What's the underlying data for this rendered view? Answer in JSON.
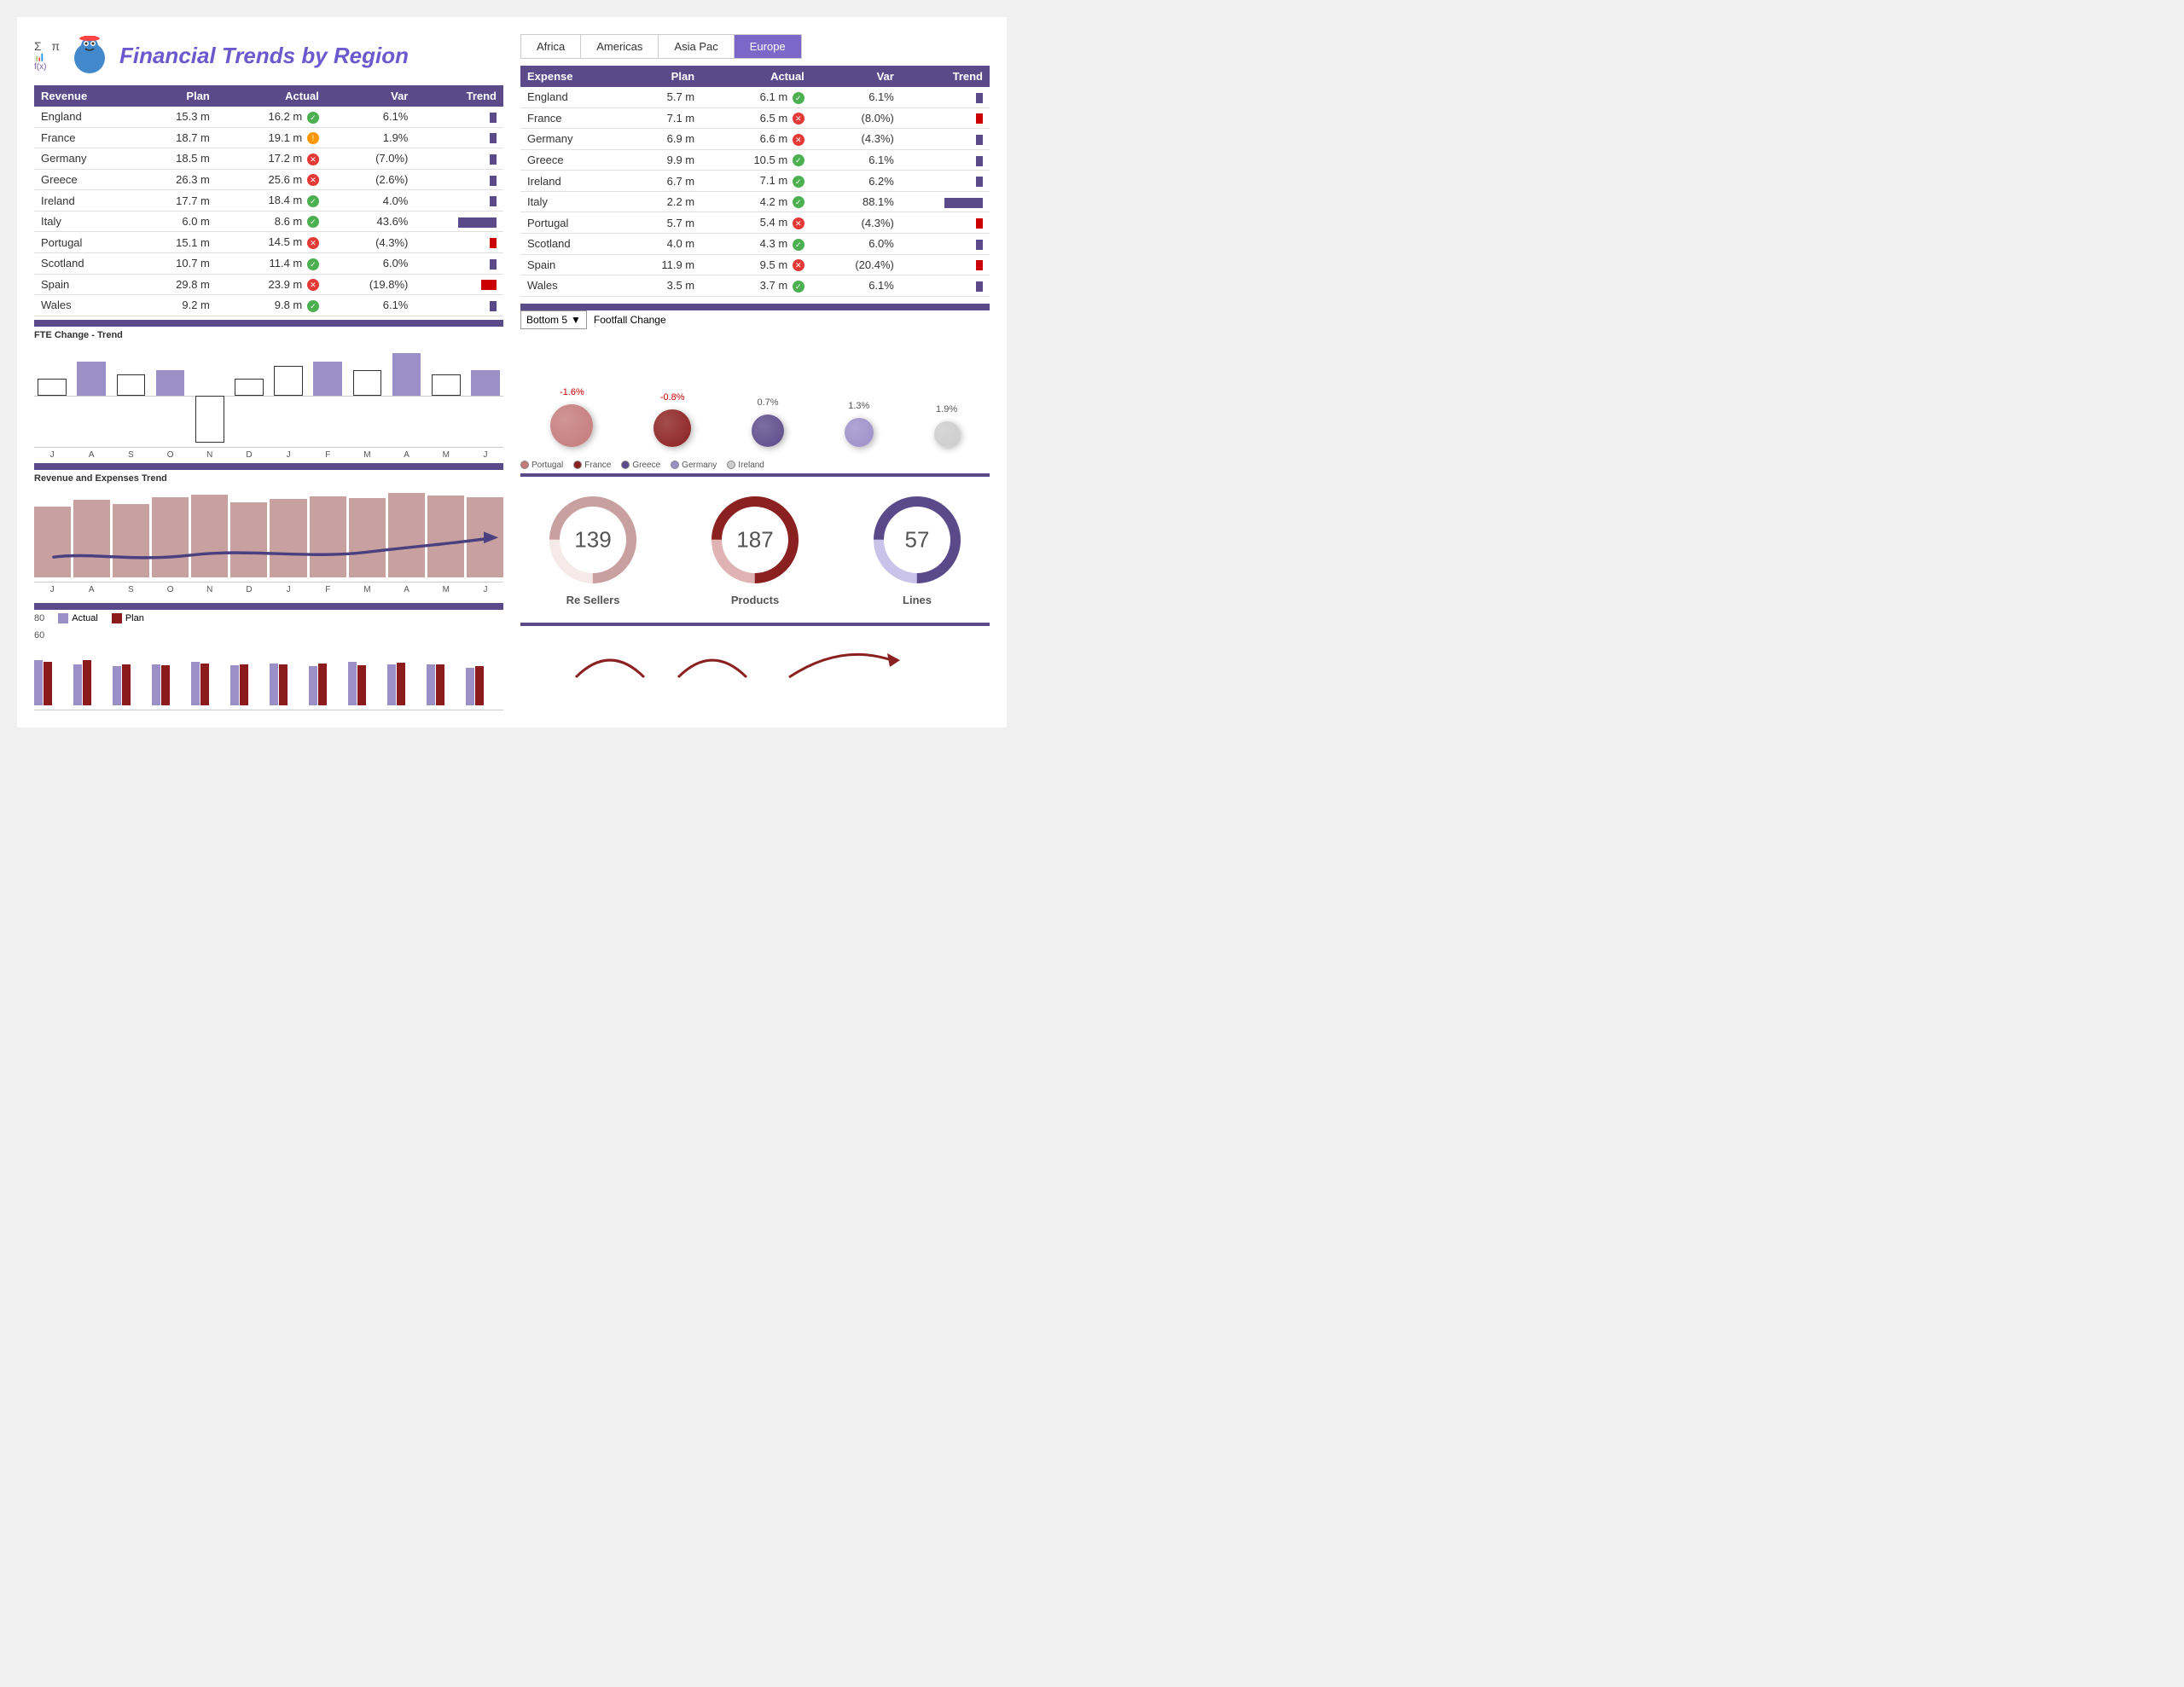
{
  "title": "Financial Trends by Region",
  "tabs": [
    {
      "label": "Africa",
      "active": false
    },
    {
      "label": "Americas",
      "active": false
    },
    {
      "label": "Asia Pac",
      "active": false
    },
    {
      "label": "Europe",
      "active": true
    }
  ],
  "revenue_table": {
    "headers": [
      "Revenue",
      "Plan",
      "Actual",
      "Var",
      "Trend"
    ],
    "rows": [
      {
        "country": "England",
        "plan": "15.3 m",
        "actual": "16.2 m",
        "icon": "check",
        "var": "6.1%",
        "var_neg": false,
        "trend_type": "purple-sm"
      },
      {
        "country": "France",
        "plan": "18.7 m",
        "actual": "19.1 m",
        "icon": "warn",
        "var": "1.9%",
        "var_neg": false,
        "trend_type": "purple-sm"
      },
      {
        "country": "Germany",
        "plan": "18.5 m",
        "actual": "17.2 m",
        "icon": "x",
        "var": "(7.0%)",
        "var_neg": true,
        "trend_type": "purple-sm"
      },
      {
        "country": "Greece",
        "plan": "26.3 m",
        "actual": "25.6 m",
        "icon": "x",
        "var": "(2.6%)",
        "var_neg": true,
        "trend_type": "purple-sm"
      },
      {
        "country": "Ireland",
        "plan": "17.7 m",
        "actual": "18.4 m",
        "icon": "check",
        "var": "4.0%",
        "var_neg": false,
        "trend_type": "purple-sm"
      },
      {
        "country": "Italy",
        "plan": "6.0 m",
        "actual": "8.6 m",
        "icon": "check",
        "var": "43.6%",
        "var_neg": false,
        "trend_type": "purple-xl"
      },
      {
        "country": "Portugal",
        "plan": "15.1 m",
        "actual": "14.5 m",
        "icon": "x",
        "var": "(4.3%)",
        "var_neg": true,
        "trend_type": "red-sm"
      },
      {
        "country": "Scotland",
        "plan": "10.7 m",
        "actual": "11.4 m",
        "icon": "check",
        "var": "6.0%",
        "var_neg": false,
        "trend_type": "purple-sm"
      },
      {
        "country": "Spain",
        "plan": "29.8 m",
        "actual": "23.9 m",
        "icon": "x",
        "var": "(19.8%)",
        "var_neg": true,
        "trend_type": "red-md"
      },
      {
        "country": "Wales",
        "plan": "9.2 m",
        "actual": "9.8 m",
        "icon": "check",
        "var": "6.1%",
        "var_neg": false,
        "trend_type": "purple-sm"
      }
    ]
  },
  "expense_table": {
    "headers": [
      "Expense",
      "Plan",
      "Actual",
      "Var",
      "Trend"
    ],
    "rows": [
      {
        "country": "England",
        "plan": "5.7 m",
        "actual": "6.1 m",
        "icon": "check",
        "var": "6.1%",
        "var_neg": false,
        "trend_type": "purple-sm"
      },
      {
        "country": "France",
        "plan": "7.1 m",
        "actual": "6.5 m",
        "icon": "x",
        "var": "(8.0%)",
        "var_neg": true,
        "trend_type": "red-sm"
      },
      {
        "country": "Germany",
        "plan": "6.9 m",
        "actual": "6.6 m",
        "icon": "x",
        "var": "(4.3%)",
        "var_neg": true,
        "trend_type": "purple-sm"
      },
      {
        "country": "Greece",
        "plan": "9.9 m",
        "actual": "10.5 m",
        "icon": "check",
        "var": "6.1%",
        "var_neg": false,
        "trend_type": "purple-sm"
      },
      {
        "country": "Ireland",
        "plan": "6.7 m",
        "actual": "7.1 m",
        "icon": "check",
        "var": "6.2%",
        "var_neg": false,
        "trend_type": "purple-sm"
      },
      {
        "country": "Italy",
        "plan": "2.2 m",
        "actual": "4.2 m",
        "icon": "check",
        "var": "88.1%",
        "var_neg": false,
        "trend_type": "purple-xl"
      },
      {
        "country": "Portugal",
        "plan": "5.7 m",
        "actual": "5.4 m",
        "icon": "x",
        "var": "(4.3%)",
        "var_neg": true,
        "trend_type": "red-sm"
      },
      {
        "country": "Scotland",
        "plan": "4.0 m",
        "actual": "4.3 m",
        "icon": "check",
        "var": "6.0%",
        "var_neg": false,
        "trend_type": "purple-sm"
      },
      {
        "country": "Spain",
        "plan": "11.9 m",
        "actual": "9.5 m",
        "icon": "x",
        "var": "(20.4%)",
        "var_neg": true,
        "trend_type": "red-sm"
      },
      {
        "country": "Wales",
        "plan": "3.5 m",
        "actual": "3.7 m",
        "icon": "check",
        "var": "6.1%",
        "var_neg": false,
        "trend_type": "purple-sm"
      }
    ]
  },
  "fte_chart": {
    "title": "FTE Change - Trend",
    "months": [
      "J",
      "A",
      "S",
      "O",
      "N",
      "D",
      "J",
      "F",
      "M",
      "A",
      "M",
      "J"
    ],
    "bars": [
      {
        "height": 20,
        "type": "outline",
        "side": "up"
      },
      {
        "height": 40,
        "type": "filled",
        "side": "up"
      },
      {
        "height": 25,
        "type": "outline",
        "side": "up"
      },
      {
        "height": 30,
        "type": "filled",
        "side": "up"
      },
      {
        "height": 55,
        "type": "outline-neg",
        "side": "down"
      },
      {
        "height": 20,
        "type": "outline",
        "side": "up"
      },
      {
        "height": 35,
        "type": "outline",
        "side": "up"
      },
      {
        "height": 40,
        "type": "filled",
        "side": "up"
      },
      {
        "height": 30,
        "type": "outline",
        "side": "up"
      },
      {
        "height": 50,
        "type": "filled",
        "side": "up"
      },
      {
        "height": 25,
        "type": "outline",
        "side": "up"
      },
      {
        "height": 30,
        "type": "filled",
        "side": "up"
      }
    ]
  },
  "rev_expenses_chart": {
    "title": "Revenue and Expenses Trend",
    "months": [
      "J",
      "A",
      "S",
      "O",
      "N",
      "D",
      "J",
      "F",
      "M",
      "A",
      "M",
      "J"
    ],
    "bars": [
      75,
      82,
      78,
      85,
      88,
      80,
      83,
      86,
      84,
      90,
      87,
      85
    ]
  },
  "bottom_bar_chart": {
    "y_max": 80,
    "y_labels": [
      "80",
      "60"
    ],
    "legend": [
      {
        "label": "Actual",
        "color": "#9b8fc8"
      },
      {
        "label": "Plan",
        "color": "#8b1a1a"
      }
    ],
    "months": [
      "J",
      "A",
      "S",
      "O",
      "N",
      "D",
      "J",
      "F",
      "M",
      "A",
      "M",
      "J"
    ],
    "bars": [
      {
        "actual": 60,
        "plan": 58
      },
      {
        "actual": 55,
        "plan": 60
      },
      {
        "actual": 52,
        "plan": 55
      },
      {
        "actual": 54,
        "plan": 53
      },
      {
        "actual": 58,
        "plan": 56
      },
      {
        "actual": 53,
        "plan": 55
      },
      {
        "actual": 56,
        "plan": 54
      },
      {
        "actual": 52,
        "plan": 56
      },
      {
        "actual": 58,
        "plan": 53
      },
      {
        "actual": 55,
        "plan": 57
      },
      {
        "actual": 54,
        "plan": 54
      },
      {
        "actual": 50,
        "plan": 52
      }
    ]
  },
  "footfall": {
    "dropdown_label": "Bottom 5",
    "title": "Footfall Change",
    "items": [
      {
        "label": "Portugal",
        "pct": "-1.6%",
        "neg": true,
        "size": 50,
        "color": "#c47a7a"
      },
      {
        "label": "France",
        "pct": "-0.8%",
        "neg": true,
        "size": 44,
        "color": "#8b2020"
      },
      {
        "label": "Greece",
        "pct": "0.7%",
        "neg": false,
        "size": 38,
        "color": "#5b4a8a"
      },
      {
        "label": "Germany",
        "pct": "1.3%",
        "neg": false,
        "size": 34,
        "color": "#9b8fc8"
      },
      {
        "label": "Ireland",
        "pct": "1.9%",
        "neg": false,
        "size": 30,
        "color": "#cccccc"
      }
    ]
  },
  "donuts": [
    {
      "value": 139,
      "label": "Re Sellers",
      "color": "#c9a0a0",
      "bg": "#e8c8c8"
    },
    {
      "value": 187,
      "label": "Products",
      "color": "#8b2020",
      "bg": "#b04040"
    },
    {
      "value": 57,
      "label": "Lines",
      "color": "#5b4a8a",
      "bg": "#7b68c8"
    }
  ]
}
